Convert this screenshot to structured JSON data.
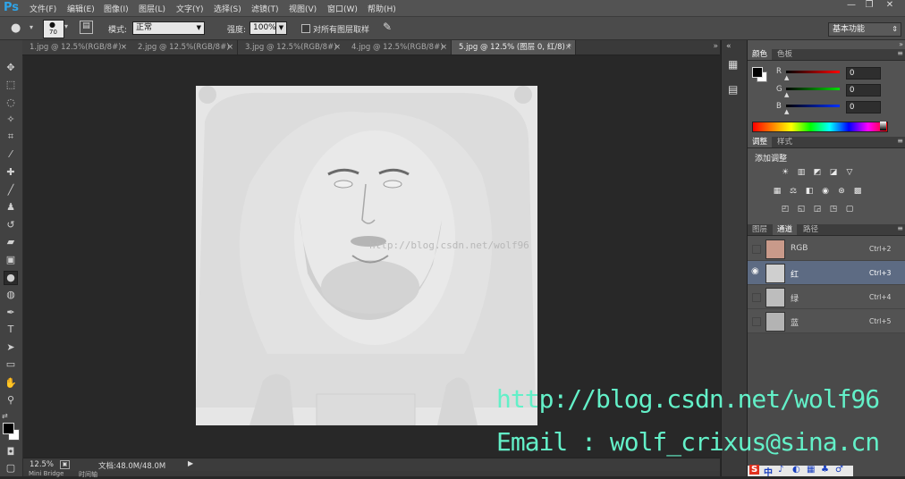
{
  "app": {
    "logo": "Ps"
  },
  "menu": [
    "文件(F)",
    "编辑(E)",
    "图像(I)",
    "图层(L)",
    "文字(Y)",
    "选择(S)",
    "滤镜(T)",
    "视图(V)",
    "窗口(W)",
    "帮助(H)"
  ],
  "window_buttons": [
    "—",
    "❐",
    "✕"
  ],
  "options": {
    "brush_size": "70",
    "mode_label": "模式:",
    "mode_value": "正常",
    "strength_label": "强度:",
    "strength_value": "100%",
    "sample_all_label": "对所有图层取样",
    "workspace": "基本功能"
  },
  "tabs": [
    {
      "label": "1.jpg @ 12.5%(RGB/8#)",
      "active": false
    },
    {
      "label": "2.jpg @ 12.5%(RGB/8#)",
      "active": false
    },
    {
      "label": "3.jpg @ 12.5%(RGB/8#)",
      "active": false
    },
    {
      "label": "4.jpg @ 12.5%(RGB/8#)",
      "active": false
    },
    {
      "label": "5.jpg @ 12.5% (图层 0, 红/8) *",
      "active": true
    }
  ],
  "canvas": {
    "url_overlay": "http://blog.csdn.net/wolf96"
  },
  "status": {
    "zoom": "12.5%",
    "doc": "文档:48.0M/48.0M"
  },
  "bottom_tabs": [
    "Mini Bridge",
    "时间轴"
  ],
  "color_panel": {
    "tabs": [
      "颜色",
      "色板"
    ],
    "channels": [
      {
        "label": "R",
        "value": "0",
        "color": "#d42020"
      },
      {
        "label": "G",
        "value": "0",
        "color": "#22a822"
      },
      {
        "label": "B",
        "value": "0",
        "color": "#2a3ad6"
      }
    ]
  },
  "adjust_panel": {
    "tabs": [
      "调整",
      "样式"
    ],
    "title": "添加调整"
  },
  "channels_panel": {
    "tabs": [
      "图层",
      "通道",
      "路径"
    ],
    "rows": [
      {
        "name": "RGB",
        "shortcut": "Ctrl+2",
        "selected": false,
        "eye": false
      },
      {
        "name": "红",
        "shortcut": "Ctrl+3",
        "selected": true,
        "eye": true
      },
      {
        "name": "绿",
        "shortcut": "Ctrl+4",
        "selected": false,
        "eye": false
      },
      {
        "name": "蓝",
        "shortcut": "Ctrl+5",
        "selected": false,
        "eye": false
      }
    ]
  },
  "watermark": {
    "line1": "http://blog.csdn.net/wolf96",
    "line2": "Email : wolf_crixus@sina.cn"
  },
  "tray": [
    "S",
    "中",
    "♪",
    "◐",
    "▦",
    "♣",
    "♂"
  ],
  "colors": {
    "accent": "#2fa4e7",
    "selection": "#5d6b83",
    "watermark": "#63f0c8"
  }
}
